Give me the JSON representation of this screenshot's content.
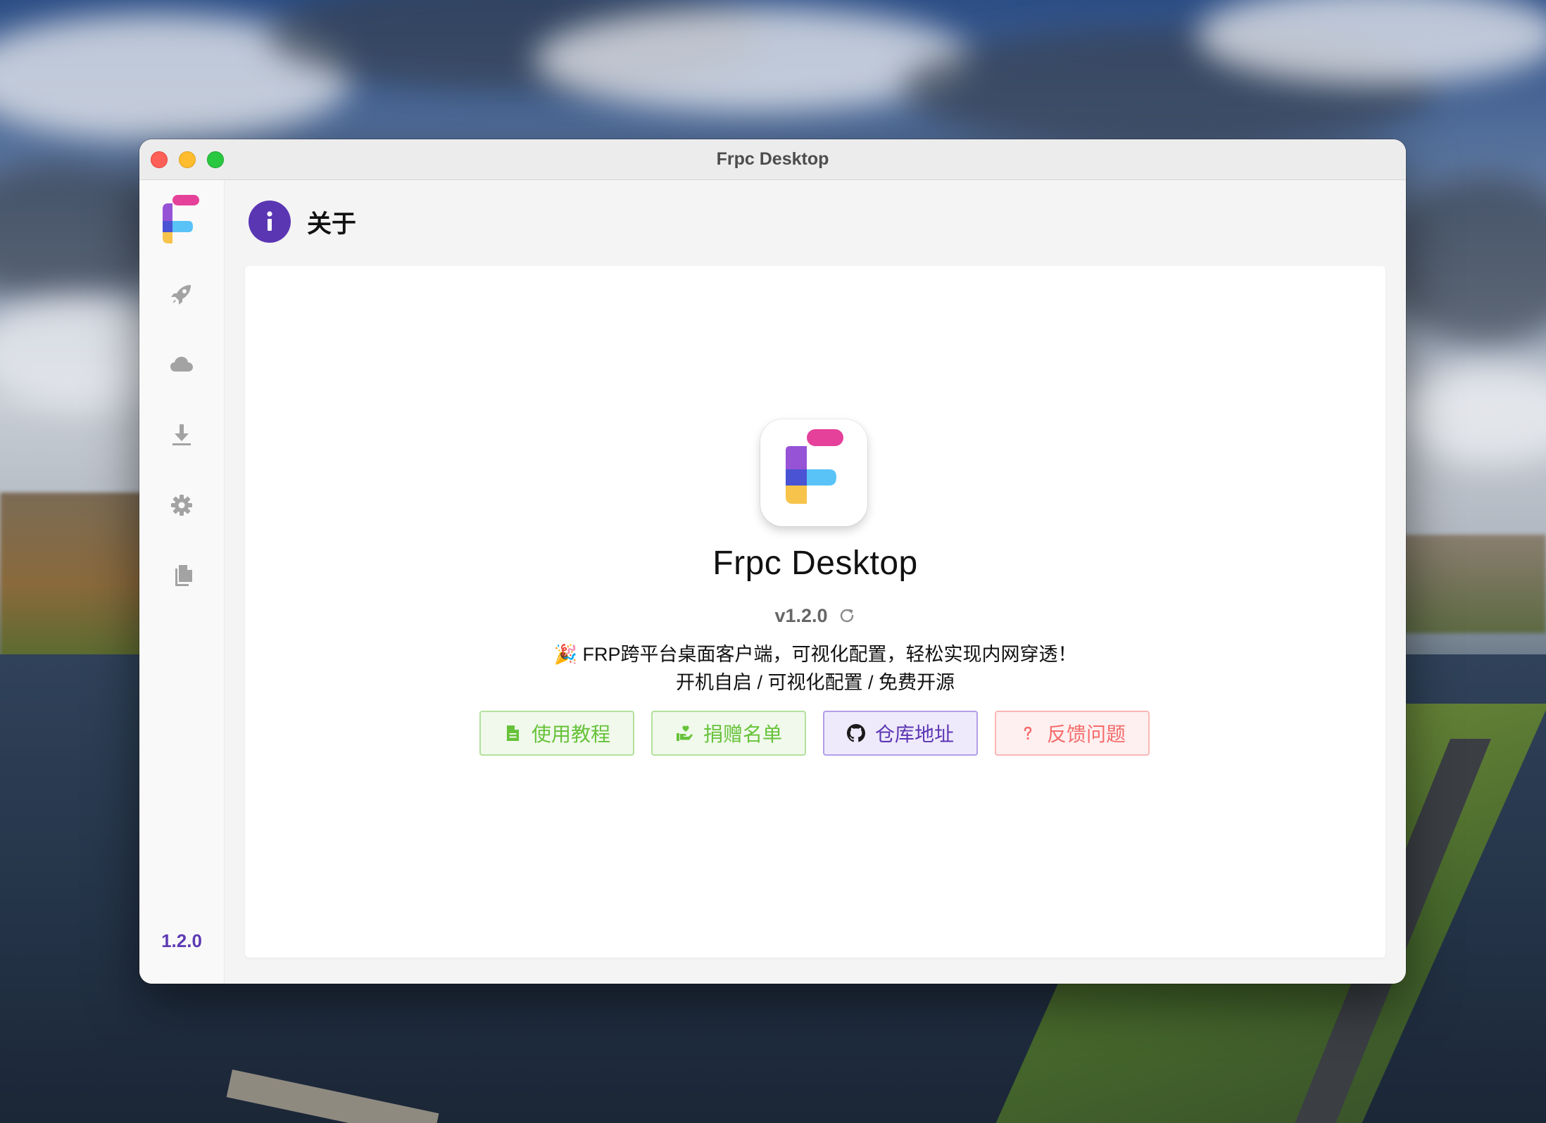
{
  "window": {
    "title": "Frpc Desktop"
  },
  "sidebar": {
    "items": [
      {
        "name": "rocket-icon",
        "label": ""
      },
      {
        "name": "cloud-icon",
        "label": ""
      },
      {
        "name": "download-icon",
        "label": ""
      },
      {
        "name": "gear-icon",
        "label": ""
      },
      {
        "name": "document-icon",
        "label": ""
      }
    ],
    "version": "1.2.0"
  },
  "header": {
    "icon": "info-icon",
    "title": "关于"
  },
  "about": {
    "app_name": "Frpc Desktop",
    "version": "v1.2.0",
    "description_line1": "🎉 FRP跨平台桌面客户端，可视化配置，轻松实现内网穿透！",
    "description_line2": "开机自启 / 可视化配置 / 免费开源"
  },
  "buttons": {
    "tutorial": "使用教程",
    "donors": "捐赠名单",
    "repository": "仓库地址",
    "feedback": "反馈问题"
  },
  "colors": {
    "accent": "#5b36b3",
    "success": "#67c23a",
    "danger": "#f56c6c",
    "logo_pink": "#e5409a",
    "logo_purple": "#9653d6",
    "logo_indigo": "#4953d4",
    "logo_blue": "#59c3f7",
    "logo_yellow": "#f7c34a"
  }
}
